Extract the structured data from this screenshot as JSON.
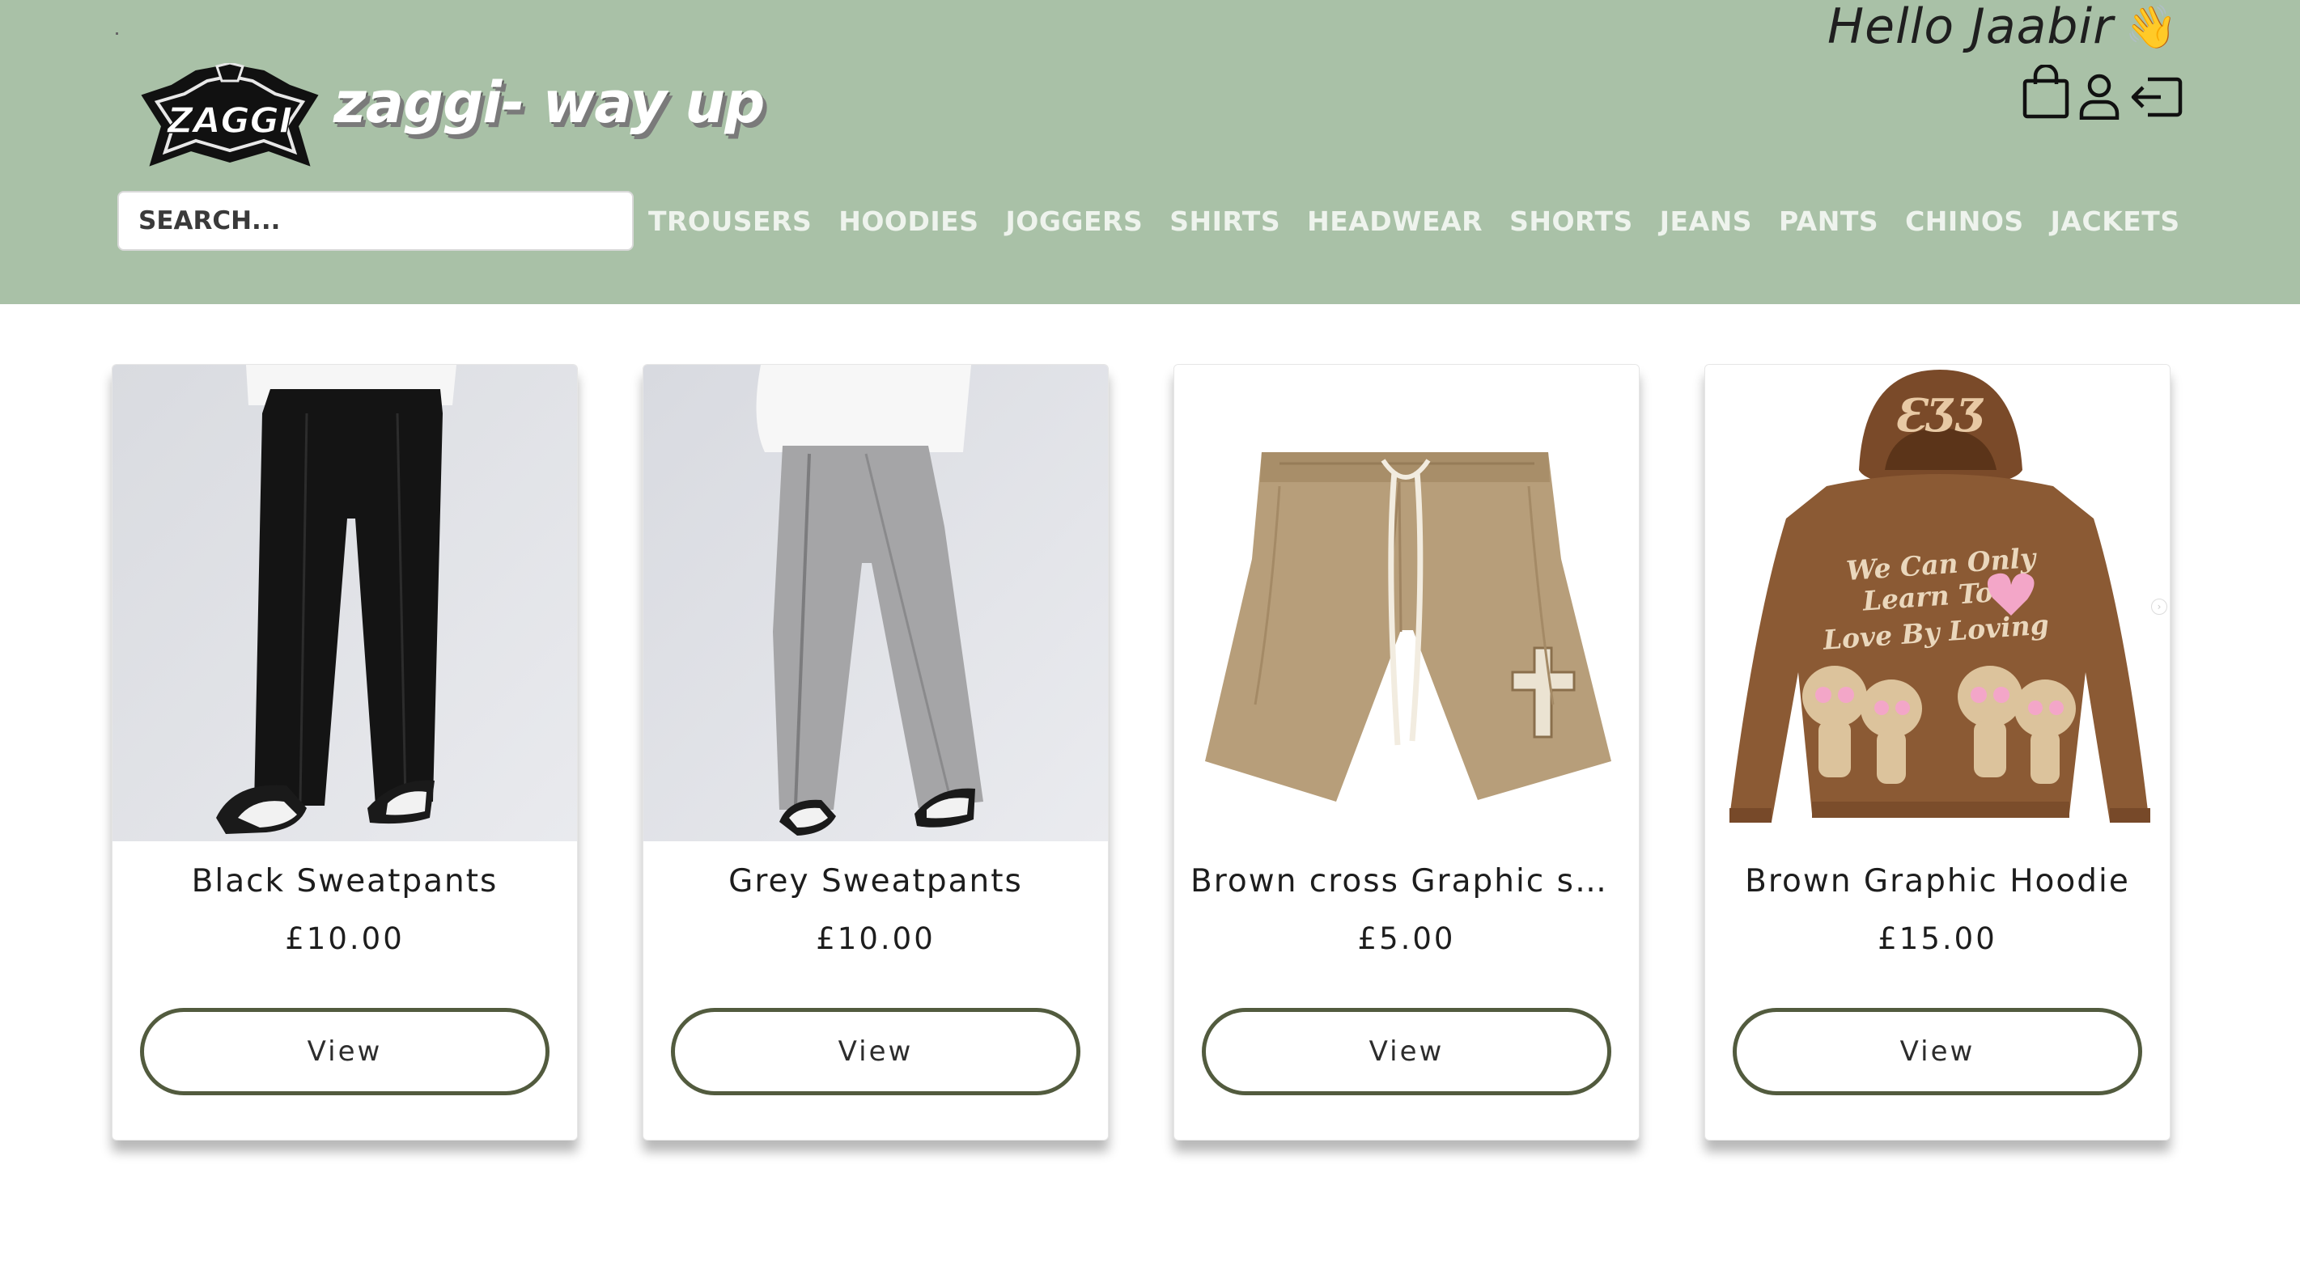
{
  "header": {
    "greeting": "Hello Jaabir",
    "greeting_emoji": "👋",
    "brand_name": "zaggi- way up",
    "logo_text": "ZAGGI",
    "icons": [
      "shopping-bag-icon",
      "user-icon",
      "logout-icon"
    ],
    "search_placeholder": "SEARCH...",
    "colors": {
      "header_bg": "#a9c1a7",
      "nav_text": "#eef3ed",
      "button_border": "#525b3e"
    }
  },
  "nav": {
    "items": [
      {
        "label": "TROUSERS"
      },
      {
        "label": "HOODIES"
      },
      {
        "label": "JOGGERS"
      },
      {
        "label": "SHIRTS"
      },
      {
        "label": "HEADWEAR"
      },
      {
        "label": "SHORTS"
      },
      {
        "label": "JEANS"
      },
      {
        "label": "PANTS"
      },
      {
        "label": "CHINOS"
      },
      {
        "label": "JACKETS"
      }
    ]
  },
  "products": [
    {
      "name": "Black Sweatpants",
      "price": "£10.00",
      "button": "View"
    },
    {
      "name": "Grey Sweatpants",
      "price": "£10.00",
      "button": "View"
    },
    {
      "name": "Brown cross Graphic sh...",
      "price": "£5.00",
      "button": "View"
    },
    {
      "name": "Brown Graphic Hoodie",
      "price": "£15.00",
      "button": "View",
      "print_text": "We Can Only Learn To Love By Loving"
    }
  ]
}
